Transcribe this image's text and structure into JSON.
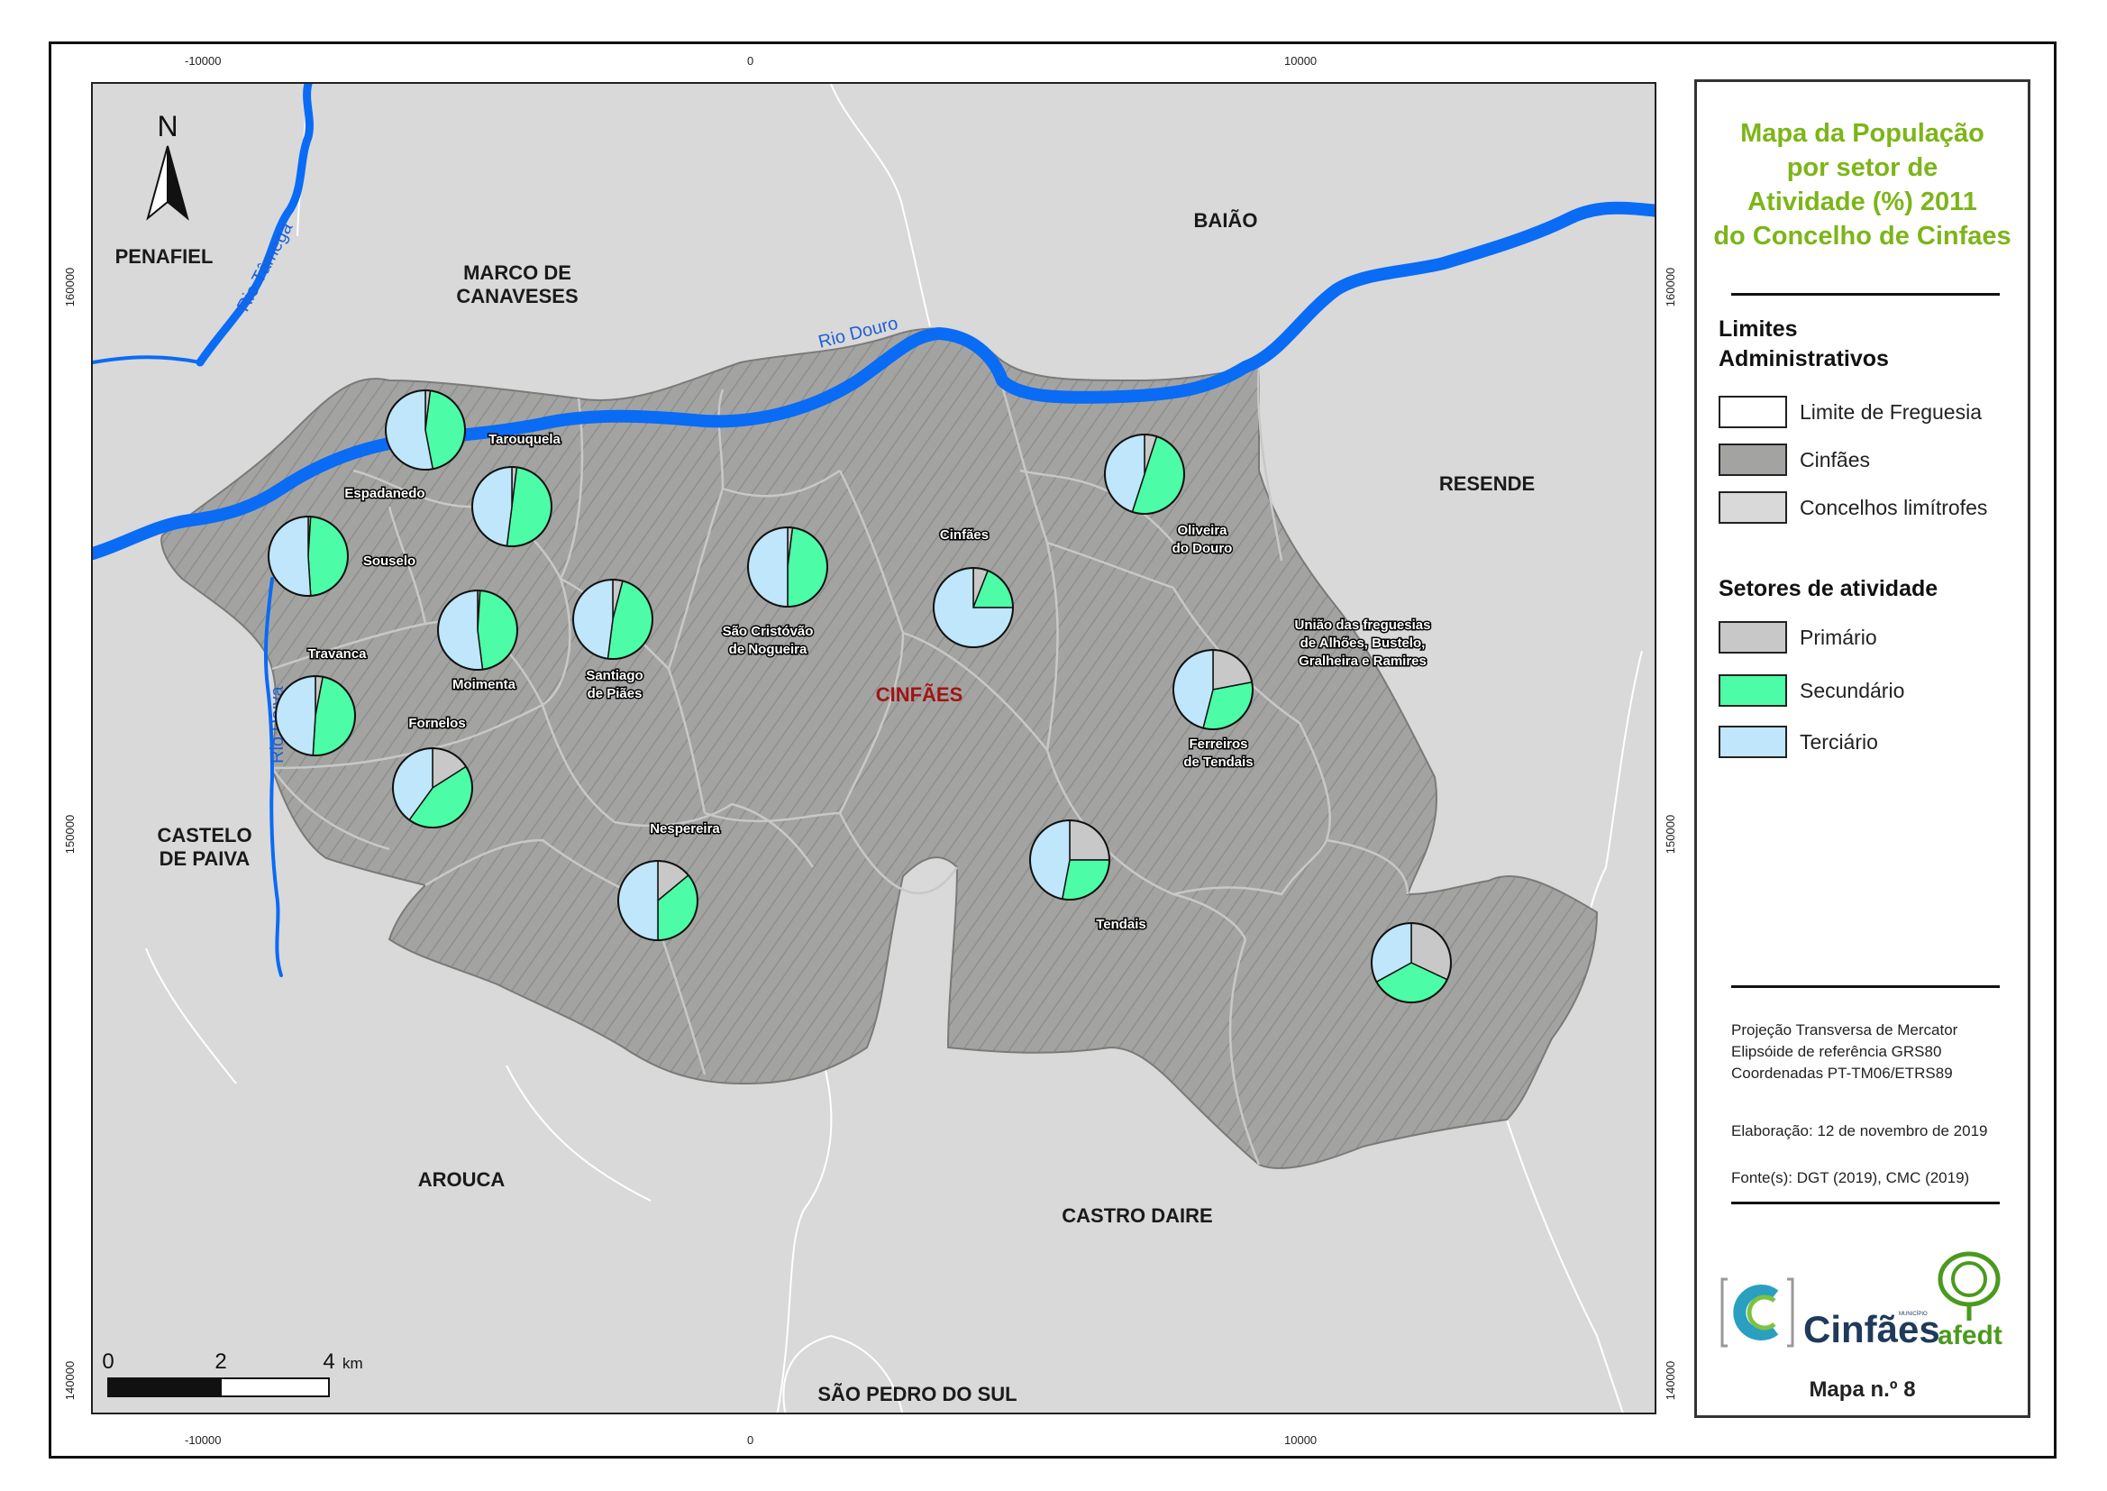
{
  "map": {
    "grid_x": [
      "-10000",
      "0",
      "10000"
    ],
    "grid_y": [
      "160000",
      "150000",
      "140000"
    ],
    "north_label": "N",
    "scale": {
      "labels": [
        "0",
        "2",
        "4"
      ],
      "unit": "km"
    },
    "neighbors": {
      "penafiel": "PENAFIEL",
      "marco_1": "MARCO DE",
      "marco_2": "CANAVESES",
      "baiao": "BAIÃO",
      "resende": "RESENDE",
      "castelo_1": "CASTELO",
      "castelo_2": "DE PAIVA",
      "arouca": "AROUCA",
      "castro_daire": "CASTRO DAIRE",
      "sao_pedro": "SÃO PEDRO DO SUL"
    },
    "rivers": {
      "tamega": "Rio Tâmega",
      "douro": "Rio Douro",
      "paiva": "Rio Paiva"
    },
    "municipality_label": "CINFÃES",
    "parishes": [
      {
        "id": "tarouquela",
        "lines": [
          "Tarouquela"
        ],
        "pie": [
          2,
          45,
          53
        ]
      },
      {
        "id": "espadanedo",
        "lines": [
          "Espadanedo"
        ],
        "pie": [
          2,
          50,
          48
        ]
      },
      {
        "id": "souselo",
        "lines": [
          "Souselo"
        ],
        "pie": [
          1,
          48,
          51
        ]
      },
      {
        "id": "moimenta",
        "lines": [
          "Moimenta"
        ],
        "pie": [
          1,
          47,
          52
        ]
      },
      {
        "id": "santiago",
        "lines": [
          "Santiago",
          "de Piães"
        ],
        "pie": [
          4,
          48,
          48
        ]
      },
      {
        "id": "sao_cristovao",
        "lines": [
          "São Cristóvão",
          "de Nogueira"
        ],
        "pie": [
          2,
          48,
          50
        ]
      },
      {
        "id": "cinfaes",
        "lines": [
          "Cinfães"
        ],
        "pie": [
          6,
          19,
          75
        ]
      },
      {
        "id": "oliveira",
        "lines": [
          "Oliveira",
          "do Douro"
        ],
        "pie": [
          5,
          50,
          45
        ]
      },
      {
        "id": "travanca",
        "lines": [
          "Travanca"
        ],
        "pie": [
          3,
          48,
          49
        ]
      },
      {
        "id": "fornelos",
        "lines": [
          "Fornelos"
        ],
        "pie": [
          16,
          44,
          40
        ]
      },
      {
        "id": "ferreiros",
        "lines": [
          "Ferreiros",
          "de Tendais"
        ],
        "pie": [
          22,
          32,
          46
        ]
      },
      {
        "id": "uniao",
        "lines": [
          "União das freguesias",
          "de Alhões, Bustelo,",
          "Gralheira e Ramires"
        ],
        "pie": [
          32,
          35,
          33
        ]
      },
      {
        "id": "nespereira",
        "lines": [
          "Nespereira"
        ],
        "pie": [
          14,
          36,
          50
        ]
      },
      {
        "id": "tendais",
        "lines": [
          "Tendais"
        ],
        "pie": [
          25,
          28,
          47
        ]
      }
    ]
  },
  "legend": {
    "title_lines": [
      "Mapa da População",
      "por setor de",
      "Atividade (%) 2011",
      "do Concelho de Cinfaes"
    ],
    "section_admin": [
      "Limites",
      "Administrativos"
    ],
    "admin_items": [
      "Limite de Freguesia",
      "Cinfães",
      "Concelhos limítrofes"
    ],
    "section_sectors": "Setores de atividade",
    "sector_items": [
      "Primário",
      "Secundário",
      "Terciário"
    ],
    "info": {
      "projection": "Projeção Transversa de Mercator",
      "ellipsoid": "Elipsóide de referência GRS80",
      "coords": "Coordenadas PT-TM06/ETRS89",
      "elaboration": "Elaboração: 12 de novembro de 2019",
      "sources": "Fonte(s): DGT (2019), CMC (2019)"
    },
    "logo_cinfaes": "Cinfães",
    "logo_cinfaes_small": "MUNICÍPIO",
    "logo_afedt": "afedt",
    "map_number": "Mapa n.º 8"
  },
  "colors": {
    "primario": "#c8c8c8",
    "secundario": "#4dfca6",
    "terciario": "#bfe6fb",
    "municipality": "#a3a4a2",
    "neighbors": "#d9d9d9",
    "water": "#0a6bf5",
    "title": "#7cb518",
    "highlight_label": "#a01414"
  }
}
